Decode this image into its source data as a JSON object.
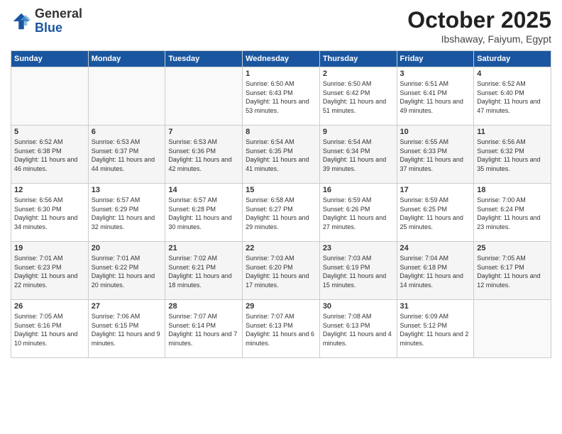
{
  "logo": {
    "general": "General",
    "blue": "Blue"
  },
  "title": "October 2025",
  "location": "Ibshaway, Faiyum, Egypt",
  "headers": [
    "Sunday",
    "Monday",
    "Tuesday",
    "Wednesday",
    "Thursday",
    "Friday",
    "Saturday"
  ],
  "weeks": [
    [
      {
        "day": "",
        "sunrise": "",
        "sunset": "",
        "daylight": ""
      },
      {
        "day": "",
        "sunrise": "",
        "sunset": "",
        "daylight": ""
      },
      {
        "day": "",
        "sunrise": "",
        "sunset": "",
        "daylight": ""
      },
      {
        "day": "1",
        "sunrise": "Sunrise: 6:50 AM",
        "sunset": "Sunset: 6:43 PM",
        "daylight": "Daylight: 11 hours and 53 minutes."
      },
      {
        "day": "2",
        "sunrise": "Sunrise: 6:50 AM",
        "sunset": "Sunset: 6:42 PM",
        "daylight": "Daylight: 11 hours and 51 minutes."
      },
      {
        "day": "3",
        "sunrise": "Sunrise: 6:51 AM",
        "sunset": "Sunset: 6:41 PM",
        "daylight": "Daylight: 11 hours and 49 minutes."
      },
      {
        "day": "4",
        "sunrise": "Sunrise: 6:52 AM",
        "sunset": "Sunset: 6:40 PM",
        "daylight": "Daylight: 11 hours and 47 minutes."
      }
    ],
    [
      {
        "day": "5",
        "sunrise": "Sunrise: 6:52 AM",
        "sunset": "Sunset: 6:38 PM",
        "daylight": "Daylight: 11 hours and 46 minutes."
      },
      {
        "day": "6",
        "sunrise": "Sunrise: 6:53 AM",
        "sunset": "Sunset: 6:37 PM",
        "daylight": "Daylight: 11 hours and 44 minutes."
      },
      {
        "day": "7",
        "sunrise": "Sunrise: 6:53 AM",
        "sunset": "Sunset: 6:36 PM",
        "daylight": "Daylight: 11 hours and 42 minutes."
      },
      {
        "day": "8",
        "sunrise": "Sunrise: 6:54 AM",
        "sunset": "Sunset: 6:35 PM",
        "daylight": "Daylight: 11 hours and 41 minutes."
      },
      {
        "day": "9",
        "sunrise": "Sunrise: 6:54 AM",
        "sunset": "Sunset: 6:34 PM",
        "daylight": "Daylight: 11 hours and 39 minutes."
      },
      {
        "day": "10",
        "sunrise": "Sunrise: 6:55 AM",
        "sunset": "Sunset: 6:33 PM",
        "daylight": "Daylight: 11 hours and 37 minutes."
      },
      {
        "day": "11",
        "sunrise": "Sunrise: 6:56 AM",
        "sunset": "Sunset: 6:32 PM",
        "daylight": "Daylight: 11 hours and 35 minutes."
      }
    ],
    [
      {
        "day": "12",
        "sunrise": "Sunrise: 6:56 AM",
        "sunset": "Sunset: 6:30 PM",
        "daylight": "Daylight: 11 hours and 34 minutes."
      },
      {
        "day": "13",
        "sunrise": "Sunrise: 6:57 AM",
        "sunset": "Sunset: 6:29 PM",
        "daylight": "Daylight: 11 hours and 32 minutes."
      },
      {
        "day": "14",
        "sunrise": "Sunrise: 6:57 AM",
        "sunset": "Sunset: 6:28 PM",
        "daylight": "Daylight: 11 hours and 30 minutes."
      },
      {
        "day": "15",
        "sunrise": "Sunrise: 6:58 AM",
        "sunset": "Sunset: 6:27 PM",
        "daylight": "Daylight: 11 hours and 29 minutes."
      },
      {
        "day": "16",
        "sunrise": "Sunrise: 6:59 AM",
        "sunset": "Sunset: 6:26 PM",
        "daylight": "Daylight: 11 hours and 27 minutes."
      },
      {
        "day": "17",
        "sunrise": "Sunrise: 6:59 AM",
        "sunset": "Sunset: 6:25 PM",
        "daylight": "Daylight: 11 hours and 25 minutes."
      },
      {
        "day": "18",
        "sunrise": "Sunrise: 7:00 AM",
        "sunset": "Sunset: 6:24 PM",
        "daylight": "Daylight: 11 hours and 23 minutes."
      }
    ],
    [
      {
        "day": "19",
        "sunrise": "Sunrise: 7:01 AM",
        "sunset": "Sunset: 6:23 PM",
        "daylight": "Daylight: 11 hours and 22 minutes."
      },
      {
        "day": "20",
        "sunrise": "Sunrise: 7:01 AM",
        "sunset": "Sunset: 6:22 PM",
        "daylight": "Daylight: 11 hours and 20 minutes."
      },
      {
        "day": "21",
        "sunrise": "Sunrise: 7:02 AM",
        "sunset": "Sunset: 6:21 PM",
        "daylight": "Daylight: 11 hours and 18 minutes."
      },
      {
        "day": "22",
        "sunrise": "Sunrise: 7:03 AM",
        "sunset": "Sunset: 6:20 PM",
        "daylight": "Daylight: 11 hours and 17 minutes."
      },
      {
        "day": "23",
        "sunrise": "Sunrise: 7:03 AM",
        "sunset": "Sunset: 6:19 PM",
        "daylight": "Daylight: 11 hours and 15 minutes."
      },
      {
        "day": "24",
        "sunrise": "Sunrise: 7:04 AM",
        "sunset": "Sunset: 6:18 PM",
        "daylight": "Daylight: 11 hours and 14 minutes."
      },
      {
        "day": "25",
        "sunrise": "Sunrise: 7:05 AM",
        "sunset": "Sunset: 6:17 PM",
        "daylight": "Daylight: 11 hours and 12 minutes."
      }
    ],
    [
      {
        "day": "26",
        "sunrise": "Sunrise: 7:05 AM",
        "sunset": "Sunset: 6:16 PM",
        "daylight": "Daylight: 11 hours and 10 minutes."
      },
      {
        "day": "27",
        "sunrise": "Sunrise: 7:06 AM",
        "sunset": "Sunset: 6:15 PM",
        "daylight": "Daylight: 11 hours and 9 minutes."
      },
      {
        "day": "28",
        "sunrise": "Sunrise: 7:07 AM",
        "sunset": "Sunset: 6:14 PM",
        "daylight": "Daylight: 11 hours and 7 minutes."
      },
      {
        "day": "29",
        "sunrise": "Sunrise: 7:07 AM",
        "sunset": "Sunset: 6:13 PM",
        "daylight": "Daylight: 11 hours and 6 minutes."
      },
      {
        "day": "30",
        "sunrise": "Sunrise: 7:08 AM",
        "sunset": "Sunset: 6:13 PM",
        "daylight": "Daylight: 11 hours and 4 minutes."
      },
      {
        "day": "31",
        "sunrise": "Sunrise: 6:09 AM",
        "sunset": "Sunset: 5:12 PM",
        "daylight": "Daylight: 11 hours and 2 minutes."
      },
      {
        "day": "",
        "sunrise": "",
        "sunset": "",
        "daylight": ""
      }
    ]
  ]
}
